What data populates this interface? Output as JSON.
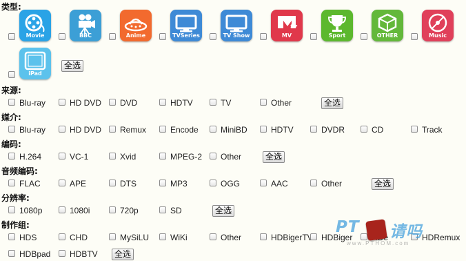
{
  "sections": {
    "type": {
      "heading": "类型:",
      "tiles": [
        {
          "caption": "Movie",
          "icon": "film-reel-icon",
          "color": "#2aa3e6"
        },
        {
          "caption": "BBC",
          "icon": "movie-camera-icon",
          "color": "#3c9fd6"
        },
        {
          "caption": "Anime",
          "icon": "ufo-icon",
          "color": "#f26a2e"
        },
        {
          "caption": "TVSeries",
          "icon": "tv-icon",
          "color": "#3e8ad6"
        },
        {
          "caption": "TV Show",
          "icon": "tv-icon",
          "color": "#3e8ad6"
        },
        {
          "caption": "MV",
          "icon": "mtv-icon",
          "color": "#e0384b"
        },
        {
          "caption": "Sport",
          "icon": "trophy-icon",
          "color": "#5cb82e"
        },
        {
          "caption": "OTHER",
          "icon": "box-icon",
          "color": "#63b83a"
        },
        {
          "caption": "Music",
          "icon": "disc-icon",
          "color": "#e0405a"
        },
        {
          "caption": "iPad",
          "icon": "tablet-icon",
          "color": "#5cc2ec"
        }
      ],
      "select_all": "全选"
    },
    "source": {
      "heading": "来源:",
      "options": [
        "Blu-ray",
        "HD DVD",
        "DVD",
        "HDTV",
        "TV",
        "Other"
      ],
      "select_all": "全选"
    },
    "medium": {
      "heading": "媒介:",
      "options": [
        "Blu-ray",
        "HD DVD",
        "Remux",
        "Encode",
        "MiniBD",
        "HDTV",
        "DVDR",
        "CD",
        "Track"
      ]
    },
    "codec": {
      "heading": "编码:",
      "options": [
        "H.264",
        "VC-1",
        "Xvid",
        "MPEG-2",
        "Other"
      ],
      "select_all": "全选"
    },
    "audio": {
      "heading": "音频编码:",
      "options": [
        "FLAC",
        "APE",
        "DTS",
        "MP3",
        "OGG",
        "AAC",
        "Other"
      ],
      "select_all": "全选"
    },
    "resolution": {
      "heading": "分辨率:",
      "options": [
        "1080p",
        "1080i",
        "720p",
        "SD"
      ],
      "select_all": "全选"
    },
    "group": {
      "heading": "制作组:",
      "options": [
        "HDS",
        "CHD",
        "MySiLU",
        "WiKi",
        "Other",
        "HDBigerTV",
        "HDBiger",
        "HDe",
        "HDRemux",
        "HDBpad",
        "HDBTV"
      ],
      "select_all": "全选"
    }
  },
  "watermark": {
    "text": "PT",
    "text2": "请吗",
    "url": "www.PTHOM.com"
  }
}
